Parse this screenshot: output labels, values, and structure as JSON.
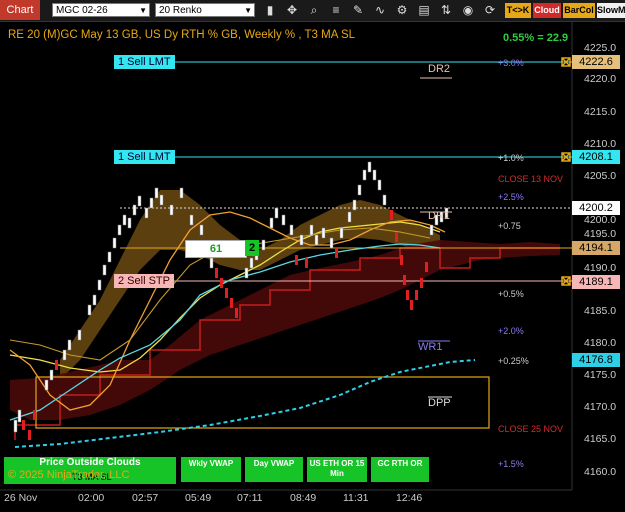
{
  "toolbar": {
    "chart_label": "Chart",
    "instrument": "MGC 02-26",
    "interval": "20 Renko",
    "btn_tk": "T<>K",
    "btn_cloud": "Cloud",
    "btn_barcol": "BarCol",
    "btn_slowm": "SlowM"
  },
  "chart_title": "RE 20  (M)GC May 13 GB, US Dy RTH % GB, Weekly % , T3 MA SL",
  "pct_readout": "0.55% = 22.9",
  "axis": {
    "y_ticks": [
      "4225.0",
      "4220.0",
      "4215.0",
      "4210.0",
      "4205.0",
      "4200.0",
      "4195.0",
      "4190.0",
      "4185.0",
      "4180.0",
      "4175.0",
      "4170.0",
      "4165.0",
      "4160.0"
    ],
    "x_ticks": [
      "26 Nov",
      "02:00",
      "02:57",
      "05:49",
      "07:11",
      "08:49",
      "11:31",
      "12:46"
    ]
  },
  "orders": {
    "sell_lmt_1": "1 Sell LMT",
    "sell_lmt_2": "1 Sell LMT",
    "sell_stp": "2 Sell STP"
  },
  "price_labels": {
    "p4222": "4222.6",
    "p4208": "4208.1",
    "p4200": "4200.2",
    "p4194": "4194.1",
    "p4189": "4189.1",
    "p4176": "4176.8"
  },
  "levels": {
    "dr2": "DR2",
    "dr1": "DR1",
    "wr1": "WR1",
    "dpp": "DPP",
    "close13": "CLOSE 13 NOV",
    "close25": "CLOSE 25 NOV",
    "plus30": "+3.0%",
    "plus10": "+1.0%",
    "plus25": "+2.5%",
    "plus075": "+0.75",
    "plus05": "+0.5%",
    "plus20": "+2.0%",
    "plus025": "+0.25%",
    "plus15": "+1.5%"
  },
  "position_box": {
    "value": "61",
    "qty": "2"
  },
  "bottom": {
    "price_outside_clouds": "Price Outside Clouds",
    "t3_ma_sl": "T3 MA SL",
    "copyright": "© 2025 NinjaTrader, LLC",
    "wkly_vwap": "Wkly VWAP",
    "day_vwap": "Day VWAP",
    "us_eth": "US ETH OR 15 Min",
    "gc_rth": "GC RTH OR"
  },
  "colors": {
    "bg": "#000000",
    "order_cyan": "#33e6f0",
    "stop_pink": "#f7b7b7",
    "gold": "#e6a817",
    "green_btn": "#17c428"
  }
}
